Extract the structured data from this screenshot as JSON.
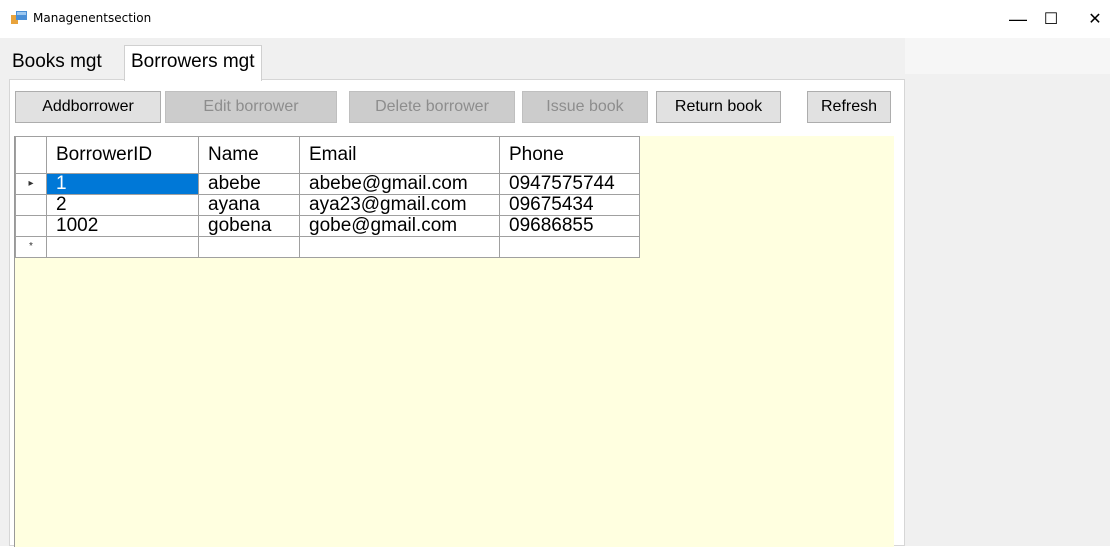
{
  "window": {
    "title": "Managenentsection",
    "minimize_glyph": "—",
    "maximize_glyph": "☐",
    "close_glyph": "✕"
  },
  "tabs": [
    {
      "label": "Books mgt",
      "active": false
    },
    {
      "label": "Borrowers mgt",
      "active": true
    }
  ],
  "toolbar": {
    "add": "Addborrower",
    "edit": "Edit borrower",
    "delete": "Delete borrower",
    "issue": "Issue book",
    "return": "Return book",
    "refresh": "Refresh"
  },
  "grid": {
    "columns": [
      "BorrowerID",
      "Name",
      "Email",
      "Phone"
    ],
    "rows": [
      {
        "indicator": "▸",
        "id": "1",
        "name": "abebe",
        "email": "abebe@gmail.com",
        "phone": "0947575744",
        "selected": true
      },
      {
        "indicator": "",
        "id": "2",
        "name": "ayana",
        "email": "aya23@gmail.com",
        "phone": "09675434",
        "selected": false
      },
      {
        "indicator": "",
        "id": "1002",
        "name": "gobena",
        "email": "gobe@gmail.com",
        "phone": "09686855",
        "selected": false
      }
    ],
    "new_row_indicator": "*"
  },
  "colors": {
    "grid_background": "#ffffe0",
    "selection": "#0078d7"
  }
}
